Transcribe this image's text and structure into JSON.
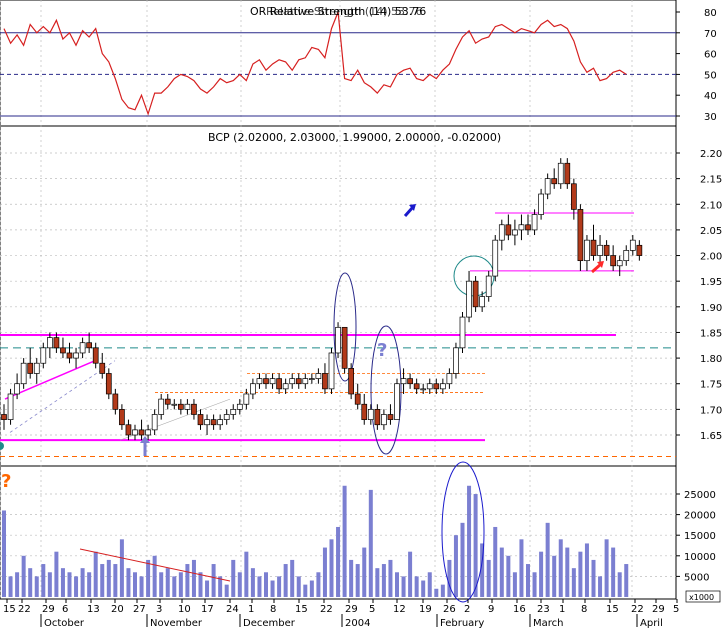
{
  "colors": {
    "up": "#ffffff",
    "down": "#b23a1a",
    "volume": "#7b7fd1",
    "rsi": "#d62020",
    "magenta": "#ff00ff",
    "teal": "#1f8a8a",
    "orange": "#ff6600",
    "blue": "#1a1acc",
    "red_arrow": "#ff2a2a",
    "grid": "#bdbdbd"
  },
  "rsi_panel": {
    "header": "OR Relative Strength (14) 53.76",
    "header_overlap": "Relative Strength (14) 53.76",
    "y_ticks": [
      "80",
      "70",
      "60",
      "50",
      "40",
      "30"
    ],
    "levels": [
      70,
      50,
      30
    ]
  },
  "price_panel": {
    "header": "BCP (2.02000, 2.03000, 1.99000, 2.00000, -0.02000)",
    "y_ticks": [
      "2.20",
      "2.15",
      "2.10",
      "2.05",
      "2.00",
      "1.95",
      "1.90",
      "1.85",
      "1.80",
      "1.75",
      "1.70",
      "1.65"
    ],
    "question_mark": "?",
    "left_question_mark": "?"
  },
  "volume_panel": {
    "y_ticks": [
      "25000",
      "20000",
      "15000",
      "10000",
      "5000"
    ],
    "multiplier": "x1000"
  },
  "x_axis": {
    "day_labels": [
      "15",
      "22",
      "29",
      "6",
      "13",
      "20",
      "27",
      "3",
      "10",
      "17",
      "24",
      "1",
      "8",
      "15",
      "22",
      "29",
      "5",
      "12",
      "19",
      "26",
      "2",
      "9",
      "16",
      "23",
      "1",
      "8",
      "15",
      "22",
      "29",
      "5",
      "1"
    ],
    "month_labels": [
      "October",
      "November",
      "December",
      "2004",
      "February",
      "March",
      "April"
    ]
  },
  "chart_data": {
    "type": "candlestick",
    "symbol": "BCP",
    "last": {
      "open": 2.02,
      "high": 2.03,
      "low": 1.99,
      "close": 2.0,
      "change": -0.02
    },
    "y_range": [
      1.61,
      2.22
    ],
    "rsi_range": [
      28,
      82
    ],
    "volume_range": [
      0,
      29000
    ],
    "candles": [
      [
        1.69,
        1.71,
        1.66,
        1.68
      ],
      [
        1.68,
        1.74,
        1.67,
        1.73
      ],
      [
        1.73,
        1.77,
        1.72,
        1.75
      ],
      [
        1.75,
        1.8,
        1.74,
        1.79
      ],
      [
        1.79,
        1.82,
        1.76,
        1.77
      ],
      [
        1.77,
        1.8,
        1.75,
        1.79
      ],
      [
        1.79,
        1.83,
        1.78,
        1.82
      ],
      [
        1.82,
        1.85,
        1.8,
        1.84
      ],
      [
        1.84,
        1.85,
        1.81,
        1.82
      ],
      [
        1.82,
        1.84,
        1.8,
        1.81
      ],
      [
        1.81,
        1.83,
        1.79,
        1.8
      ],
      [
        1.8,
        1.82,
        1.78,
        1.81
      ],
      [
        1.81,
        1.84,
        1.8,
        1.83
      ],
      [
        1.83,
        1.85,
        1.81,
        1.82
      ],
      [
        1.82,
        1.83,
        1.78,
        1.79
      ],
      [
        1.79,
        1.81,
        1.76,
        1.77
      ],
      [
        1.77,
        1.78,
        1.72,
        1.73
      ],
      [
        1.73,
        1.74,
        1.69,
        1.7
      ],
      [
        1.7,
        1.71,
        1.66,
        1.67
      ],
      [
        1.67,
        1.68,
        1.64,
        1.65
      ],
      [
        1.65,
        1.67,
        1.64,
        1.66
      ],
      [
        1.66,
        1.68,
        1.64,
        1.65
      ],
      [
        1.65,
        1.67,
        1.64,
        1.66
      ],
      [
        1.66,
        1.7,
        1.65,
        1.69
      ],
      [
        1.69,
        1.73,
        1.68,
        1.72
      ],
      [
        1.72,
        1.73,
        1.7,
        1.71
      ],
      [
        1.71,
        1.72,
        1.7,
        1.71
      ],
      [
        1.71,
        1.72,
        1.69,
        1.7
      ],
      [
        1.7,
        1.72,
        1.69,
        1.71
      ],
      [
        1.71,
        1.72,
        1.68,
        1.69
      ],
      [
        1.69,
        1.7,
        1.66,
        1.67
      ],
      [
        1.67,
        1.69,
        1.65,
        1.68
      ],
      [
        1.68,
        1.69,
        1.66,
        1.67
      ],
      [
        1.67,
        1.69,
        1.66,
        1.68
      ],
      [
        1.68,
        1.7,
        1.67,
        1.69
      ],
      [
        1.69,
        1.71,
        1.68,
        1.7
      ],
      [
        1.7,
        1.72,
        1.69,
        1.71
      ],
      [
        1.71,
        1.74,
        1.7,
        1.73
      ],
      [
        1.73,
        1.76,
        1.72,
        1.75
      ],
      [
        1.75,
        1.77,
        1.74,
        1.76
      ],
      [
        1.76,
        1.77,
        1.74,
        1.75
      ],
      [
        1.75,
        1.77,
        1.74,
        1.76
      ],
      [
        1.76,
        1.77,
        1.73,
        1.74
      ],
      [
        1.74,
        1.76,
        1.73,
        1.75
      ],
      [
        1.75,
        1.77,
        1.74,
        1.76
      ],
      [
        1.76,
        1.77,
        1.74,
        1.75
      ],
      [
        1.75,
        1.77,
        1.74,
        1.76
      ],
      [
        1.76,
        1.77,
        1.75,
        1.76
      ],
      [
        1.76,
        1.78,
        1.75,
        1.77
      ],
      [
        1.77,
        1.79,
        1.73,
        1.74
      ],
      [
        1.74,
        1.82,
        1.73,
        1.81
      ],
      [
        1.81,
        1.87,
        1.8,
        1.86
      ],
      [
        1.86,
        1.86,
        1.77,
        1.78
      ],
      [
        1.78,
        1.79,
        1.72,
        1.73
      ],
      [
        1.73,
        1.75,
        1.7,
        1.71
      ],
      [
        1.71,
        1.73,
        1.67,
        1.68
      ],
      [
        1.68,
        1.71,
        1.67,
        1.7
      ],
      [
        1.7,
        1.71,
        1.66,
        1.67
      ],
      [
        1.67,
        1.7,
        1.66,
        1.69
      ],
      [
        1.69,
        1.71,
        1.67,
        1.68
      ],
      [
        1.68,
        1.76,
        1.68,
        1.75
      ],
      [
        1.75,
        1.78,
        1.73,
        1.76
      ],
      [
        1.76,
        1.77,
        1.74,
        1.75
      ],
      [
        1.75,
        1.76,
        1.73,
        1.74
      ],
      [
        1.74,
        1.75,
        1.73,
        1.74
      ],
      [
        1.74,
        1.76,
        1.73,
        1.75
      ],
      [
        1.75,
        1.76,
        1.73,
        1.74
      ],
      [
        1.74,
        1.76,
        1.73,
        1.75
      ],
      [
        1.75,
        1.78,
        1.74,
        1.77
      ],
      [
        1.77,
        1.83,
        1.76,
        1.82
      ],
      [
        1.82,
        1.89,
        1.81,
        1.88
      ],
      [
        1.88,
        1.97,
        1.87,
        1.95
      ],
      [
        1.95,
        1.96,
        1.89,
        1.9
      ],
      [
        1.9,
        1.93,
        1.89,
        1.92
      ],
      [
        1.92,
        1.97,
        1.91,
        1.96
      ],
      [
        1.96,
        2.04,
        1.95,
        2.03
      ],
      [
        2.03,
        2.07,
        2.01,
        2.06
      ],
      [
        2.06,
        2.08,
        2.03,
        2.04
      ],
      [
        2.04,
        2.07,
        2.02,
        2.05
      ],
      [
        2.05,
        2.08,
        2.03,
        2.06
      ],
      [
        2.06,
        2.08,
        2.04,
        2.05
      ],
      [
        2.05,
        2.09,
        2.04,
        2.08
      ],
      [
        2.08,
        2.13,
        2.07,
        2.12
      ],
      [
        2.12,
        2.16,
        2.11,
        2.15
      ],
      [
        2.15,
        2.17,
        2.13,
        2.14
      ],
      [
        2.14,
        2.19,
        2.13,
        2.18
      ],
      [
        2.18,
        2.19,
        2.13,
        2.14
      ],
      [
        2.14,
        2.15,
        2.07,
        2.09
      ],
      [
        2.09,
        2.1,
        1.97,
        1.99
      ],
      [
        1.99,
        2.04,
        1.97,
        2.03
      ],
      [
        2.03,
        2.06,
        1.99,
        2.0
      ],
      [
        2.0,
        2.04,
        1.98,
        2.02
      ],
      [
        2.02,
        2.03,
        1.99,
        2.0
      ],
      [
        2.0,
        2.02,
        1.97,
        1.98
      ],
      [
        1.98,
        2.0,
        1.96,
        1.99
      ],
      [
        1.99,
        2.02,
        1.98,
        2.01
      ],
      [
        2.01,
        2.04,
        2.0,
        2.03
      ],
      [
        2.02,
        2.03,
        1.99,
        2.0
      ]
    ],
    "volume": [
      21,
      5,
      6,
      10,
      7,
      5,
      8,
      6,
      11,
      7,
      6,
      5,
      7,
      6,
      11,
      8,
      9,
      8,
      14,
      7,
      6,
      5,
      9,
      10,
      6,
      7,
      5,
      6,
      8,
      9,
      6,
      4,
      8,
      5,
      3,
      9,
      6,
      11,
      7,
      5,
      6,
      4,
      5,
      8,
      9,
      5,
      3,
      4,
      6,
      12,
      14,
      17,
      27,
      9,
      8,
      12,
      26,
      7,
      8,
      9,
      6,
      5,
      11,
      5,
      4,
      6,
      2,
      3,
      9,
      15,
      18,
      27,
      25,
      13,
      9,
      17,
      12,
      10,
      6,
      14,
      8,
      6,
      11,
      18,
      10,
      14,
      12,
      7,
      11,
      13,
      9,
      5,
      14,
      12,
      6,
      8
    ],
    "rsi": [
      72,
      65,
      69,
      64,
      74,
      70,
      73,
      70,
      76,
      67,
      70,
      64,
      71,
      68,
      72,
      60,
      56,
      48,
      38,
      34,
      33,
      40,
      31,
      41,
      41,
      44,
      48,
      50,
      49,
      47,
      43,
      41,
      44,
      48,
      46,
      47,
      50,
      47,
      55,
      57,
      52,
      55,
      57,
      56,
      52,
      57,
      58,
      63,
      62,
      58,
      72,
      80,
      48,
      47,
      52,
      46,
      44,
      41,
      45,
      44,
      50,
      52,
      53,
      48,
      47,
      50,
      48,
      52,
      55,
      62,
      68,
      71,
      65,
      67,
      68,
      73,
      74,
      72,
      70,
      72,
      71,
      70,
      74,
      76,
      73,
      74,
      72,
      66,
      56,
      51,
      53,
      47,
      48,
      51,
      52,
      50
    ]
  }
}
